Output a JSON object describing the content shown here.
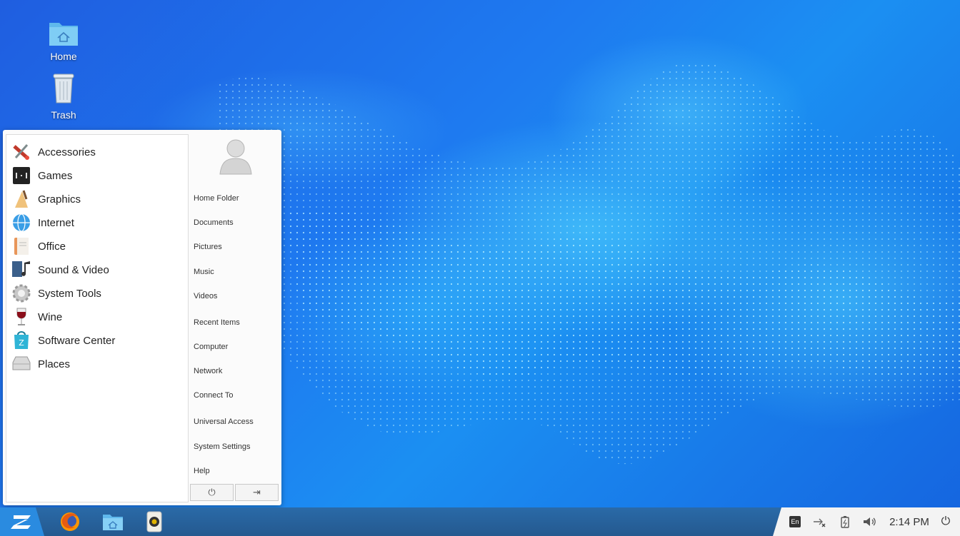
{
  "desktop": {
    "icons": [
      {
        "label": "Home"
      },
      {
        "label": "Trash"
      }
    ]
  },
  "menu": {
    "categories": [
      {
        "label": "Accessories",
        "icon": "accessories-icon"
      },
      {
        "label": "Games",
        "icon": "games-icon"
      },
      {
        "label": "Graphics",
        "icon": "graphics-icon"
      },
      {
        "label": "Internet",
        "icon": "internet-icon"
      },
      {
        "label": "Office",
        "icon": "office-icon"
      },
      {
        "label": "Sound & Video",
        "icon": "sound-video-icon"
      },
      {
        "label": "System Tools",
        "icon": "system-tools-icon"
      },
      {
        "label": "Wine",
        "icon": "wine-icon"
      },
      {
        "label": "Software Center",
        "icon": "software-center-icon"
      },
      {
        "label": "Places",
        "icon": "places-icon"
      }
    ],
    "places": [
      {
        "label": "Home Folder"
      },
      {
        "label": "Documents"
      },
      {
        "label": "Pictures"
      },
      {
        "label": "Music"
      },
      {
        "label": "Videos"
      },
      {
        "label": "Recent Items"
      },
      {
        "label": "Computer"
      },
      {
        "label": "Network"
      },
      {
        "label": "Connect To"
      },
      {
        "label": "Universal Access"
      },
      {
        "label": "System Settings"
      },
      {
        "label": "Help"
      }
    ],
    "buttons": {
      "power_glyph": "⏻",
      "logout_glyph": "⇥"
    }
  },
  "taskbar": {
    "apps": [
      "firefox-icon",
      "file-manager-icon",
      "audio-player-icon"
    ],
    "tray": {
      "keyboard_layout": "En",
      "clock": "2:14 PM",
      "power_glyph": "⏻"
    }
  },
  "colors": {
    "accent": "#2a8be0",
    "taskbar": "#24598f",
    "menu_bg": "#fbfbfb"
  }
}
